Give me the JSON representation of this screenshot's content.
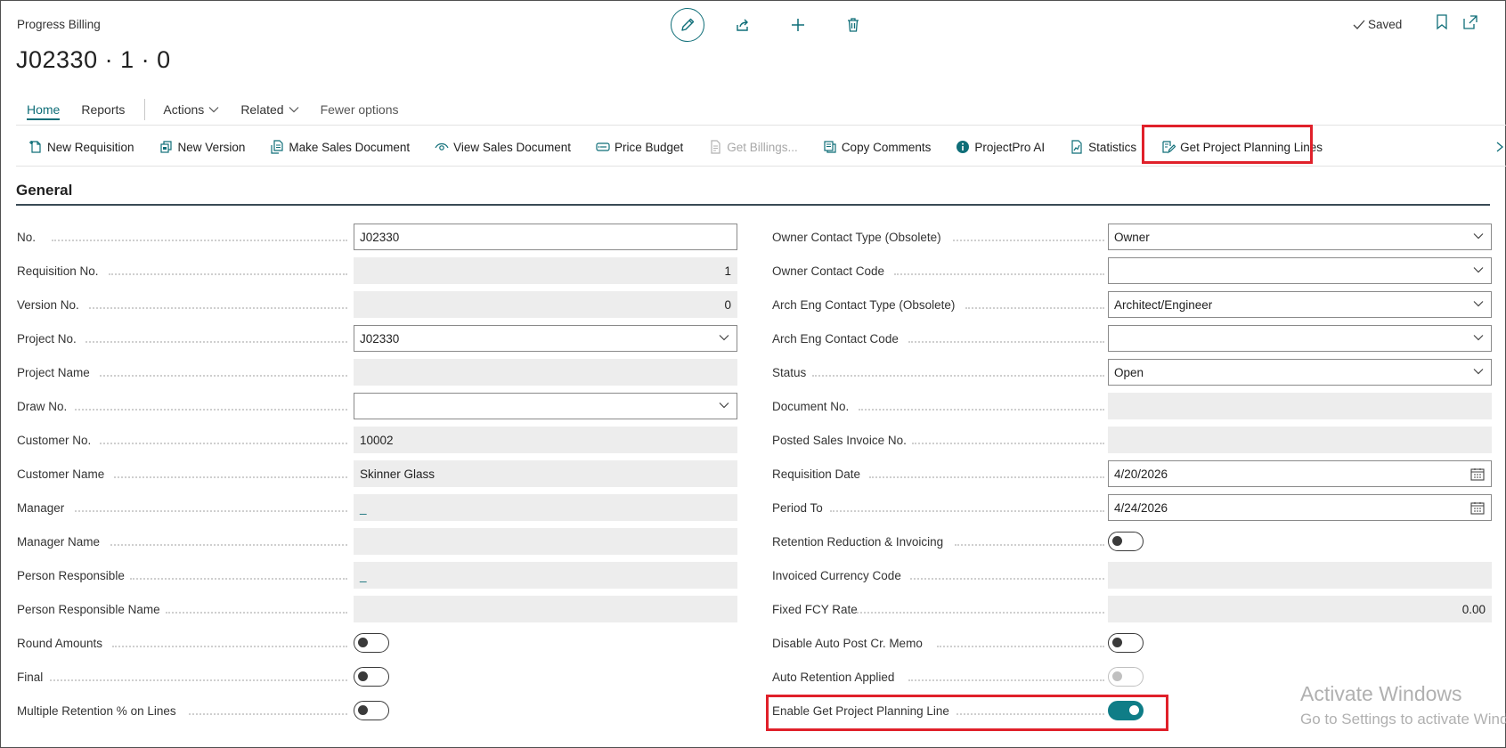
{
  "header": {
    "caption": "Progress Billing",
    "title": "J02330 · 1 · 0",
    "saved_label": "Saved"
  },
  "nav": {
    "home": "Home",
    "reports": "Reports",
    "actions": "Actions",
    "related": "Related",
    "fewer": "Fewer options"
  },
  "actions": [
    {
      "label": "New Requisition",
      "icon": "new-document-icon"
    },
    {
      "label": "New Version",
      "icon": "version-icon"
    },
    {
      "label": "Make Sales Document",
      "icon": "make-document-icon"
    },
    {
      "label": "View Sales Document",
      "icon": "eye-icon"
    },
    {
      "label": "Price Budget",
      "icon": "price-tag-icon"
    },
    {
      "label": "Get Billings...",
      "icon": "billings-icon",
      "disabled": true
    },
    {
      "label": "Copy Comments",
      "icon": "copy-icon"
    },
    {
      "label": "ProjectPro AI",
      "icon": "info-icon"
    },
    {
      "label": "Statistics",
      "icon": "chart-icon"
    },
    {
      "label": "Get Project Planning Lines",
      "icon": "edit-list-icon"
    }
  ],
  "section": {
    "title": "General"
  },
  "left_fields": {
    "no": {
      "label": "No.",
      "value": "J02330"
    },
    "requisition_no": {
      "label": "Requisition No.",
      "value": "1"
    },
    "version_no": {
      "label": "Version No.",
      "value": "0"
    },
    "project_no": {
      "label": "Project No.",
      "value": "J02330"
    },
    "project_name": {
      "label": "Project Name",
      "value": ""
    },
    "draw_no": {
      "label": "Draw No.",
      "value": ""
    },
    "customer_no": {
      "label": "Customer No.",
      "value": "10002"
    },
    "customer_name": {
      "label": "Customer Name",
      "value": "Skinner Glass"
    },
    "manager": {
      "label": "Manager",
      "value": "_"
    },
    "manager_name": {
      "label": "Manager Name",
      "value": ""
    },
    "person_responsible": {
      "label": "Person Responsible",
      "value": "_"
    },
    "person_responsible_name": {
      "label": "Person Responsible Name",
      "value": ""
    },
    "round_amounts": {
      "label": "Round Amounts",
      "on": false
    },
    "final": {
      "label": "Final",
      "on": false
    },
    "multiple_retention": {
      "label": "Multiple Retention % on Lines",
      "on": false
    }
  },
  "right_fields": {
    "owner_contact_type": {
      "label": "Owner Contact Type (Obsolete)",
      "value": "Owner"
    },
    "owner_contact_code": {
      "label": "Owner Contact Code",
      "value": ""
    },
    "arch_eng_contact_type": {
      "label": "Arch Eng Contact Type (Obsolete)",
      "value": "Architect/Engineer"
    },
    "arch_eng_contact_code": {
      "label": "Arch Eng Contact Code",
      "value": ""
    },
    "status": {
      "label": "Status",
      "value": "Open"
    },
    "document_no": {
      "label": "Document No.",
      "value": ""
    },
    "posted_sales_invoice_no": {
      "label": "Posted Sales Invoice No.",
      "value": ""
    },
    "requisition_date": {
      "label": "Requisition Date",
      "value": "4/20/2026"
    },
    "period_to": {
      "label": "Period To",
      "value": "4/24/2026"
    },
    "retention_reduction": {
      "label": "Retention Reduction & Invoicing",
      "on": false
    },
    "invoiced_currency_code": {
      "label": "Invoiced Currency Code",
      "value": ""
    },
    "fixed_fcy_rate": {
      "label": "Fixed FCY Rate",
      "value": "0.00"
    },
    "disable_auto_post": {
      "label": "Disable Auto Post Cr. Memo",
      "on": false
    },
    "auto_retention_applied": {
      "label": "Auto Retention Applied",
      "on": false
    },
    "enable_get_planning": {
      "label": "Enable Get Project Planning Line",
      "on": true
    }
  },
  "watermark": {
    "line1": "Activate Windows",
    "line2": "Go to Settings to activate Windows."
  },
  "colors": {
    "accent": "#0f6e78",
    "highlight": "#e0202a"
  }
}
